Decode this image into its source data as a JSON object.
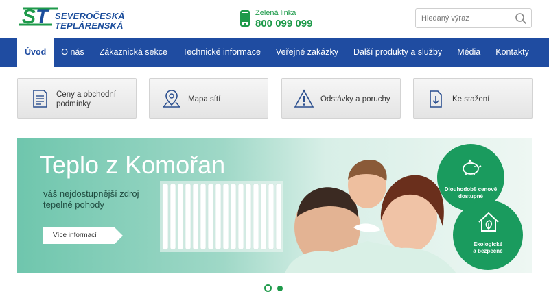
{
  "brand": {
    "line1": "SEVEROČESKÁ",
    "line2": "TEPLÁRENSKÁ",
    "logo_mark": "ST",
    "color_primary": "#1f4ca1",
    "color_green": "#1e9a4a"
  },
  "hotline": {
    "label": "Zelená linka",
    "number": "800 099 099",
    "icon": "phone-icon"
  },
  "search": {
    "placeholder": "Hledaný výraz",
    "value": "",
    "icon": "search-icon"
  },
  "nav": {
    "items": [
      {
        "label": "Úvod",
        "active": true
      },
      {
        "label": "O nás",
        "active": false
      },
      {
        "label": "Zákaznická sekce",
        "active": false
      },
      {
        "label": "Technické informace",
        "active": false
      },
      {
        "label": "Veřejné zakázky",
        "active": false
      },
      {
        "label": "Další produkty a služby",
        "active": false
      },
      {
        "label": "Média",
        "active": false
      },
      {
        "label": "Kontakty",
        "active": false
      }
    ]
  },
  "quick_links": [
    {
      "label": "Ceny a obchodní podmínky",
      "icon": "document-icon"
    },
    {
      "label": "Mapa sítí",
      "icon": "map-pin-icon"
    },
    {
      "label": "Odstávky a poruchy",
      "icon": "warning-icon"
    },
    {
      "label": "Ke stažení",
      "icon": "download-icon"
    }
  ],
  "banner": {
    "title": "Teplo z Komořan",
    "subtitle_line1": "váš nejdostupnější zdroj",
    "subtitle_line2": "tepelné pohody",
    "cta": "Více informací",
    "badge1_line1": "Dlouhodobě cenově",
    "badge1_line2": "dostupné",
    "badge1_icon": "piggy-bank-icon",
    "badge2_line1": "Ekologické",
    "badge2_line2": "a bezpečné",
    "badge2_icon": "eco-house-icon"
  },
  "slider": {
    "slides": 2,
    "active_slide": 1
  }
}
